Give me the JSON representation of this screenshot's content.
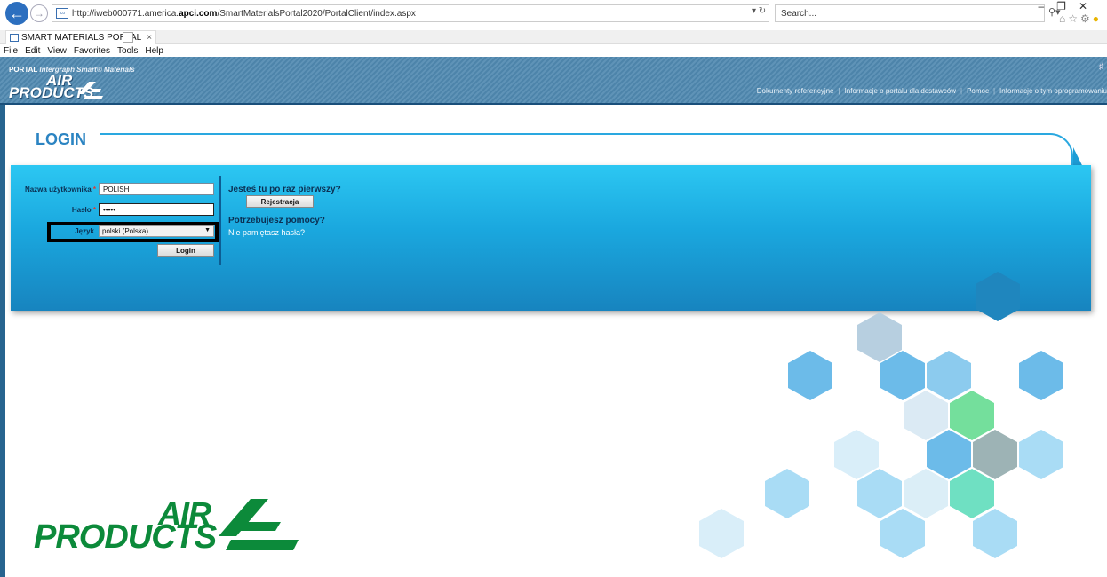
{
  "browser": {
    "url_prefix": "http://iweb000771.america.",
    "url_domain": "apci.com",
    "url_path": "/SmartMaterialsPortal2020/PortalClient/index.aspx",
    "search_placeholder": "Search...",
    "tab_title": "SMART MATERIALS PORTAL",
    "tab_close": "×",
    "menu": [
      "File",
      "Edit",
      "View",
      "Favorites",
      "Tools",
      "Help"
    ]
  },
  "header": {
    "portal_label": "PORTAL",
    "portal_product": "Intergraph Smart® Materials",
    "logo_line1": "AIR",
    "logo_line2": "PRODUCTS",
    "nav": [
      "Dokumenty referencyjne",
      "Informacje o portalu dla dostawców",
      "Pomoc",
      "Informacje o tym oprogramowaniu"
    ]
  },
  "login": {
    "title": "LOGIN",
    "username_label": "Nazwa użytkownika",
    "username_value": "POLISH",
    "password_label": "Hasło",
    "password_value": "•••••",
    "language_label": "Język",
    "language_value": "polski (Polska)",
    "login_button": "Login",
    "required_mark": "*",
    "first_time_heading": "Jesteś tu po raz pierwszy?",
    "register_button": "Rejestracja",
    "help_heading": "Potrzebujesz pomocy?",
    "forgot_password_link": "Nie pamiętasz hasła?"
  },
  "footer_logo": {
    "line1": "AIR",
    "line2": "PRODUCTS"
  },
  "colors": {
    "accent": "#2b84c2",
    "panel": "#1aa7de",
    "brand_green": "#0c8a3a"
  }
}
